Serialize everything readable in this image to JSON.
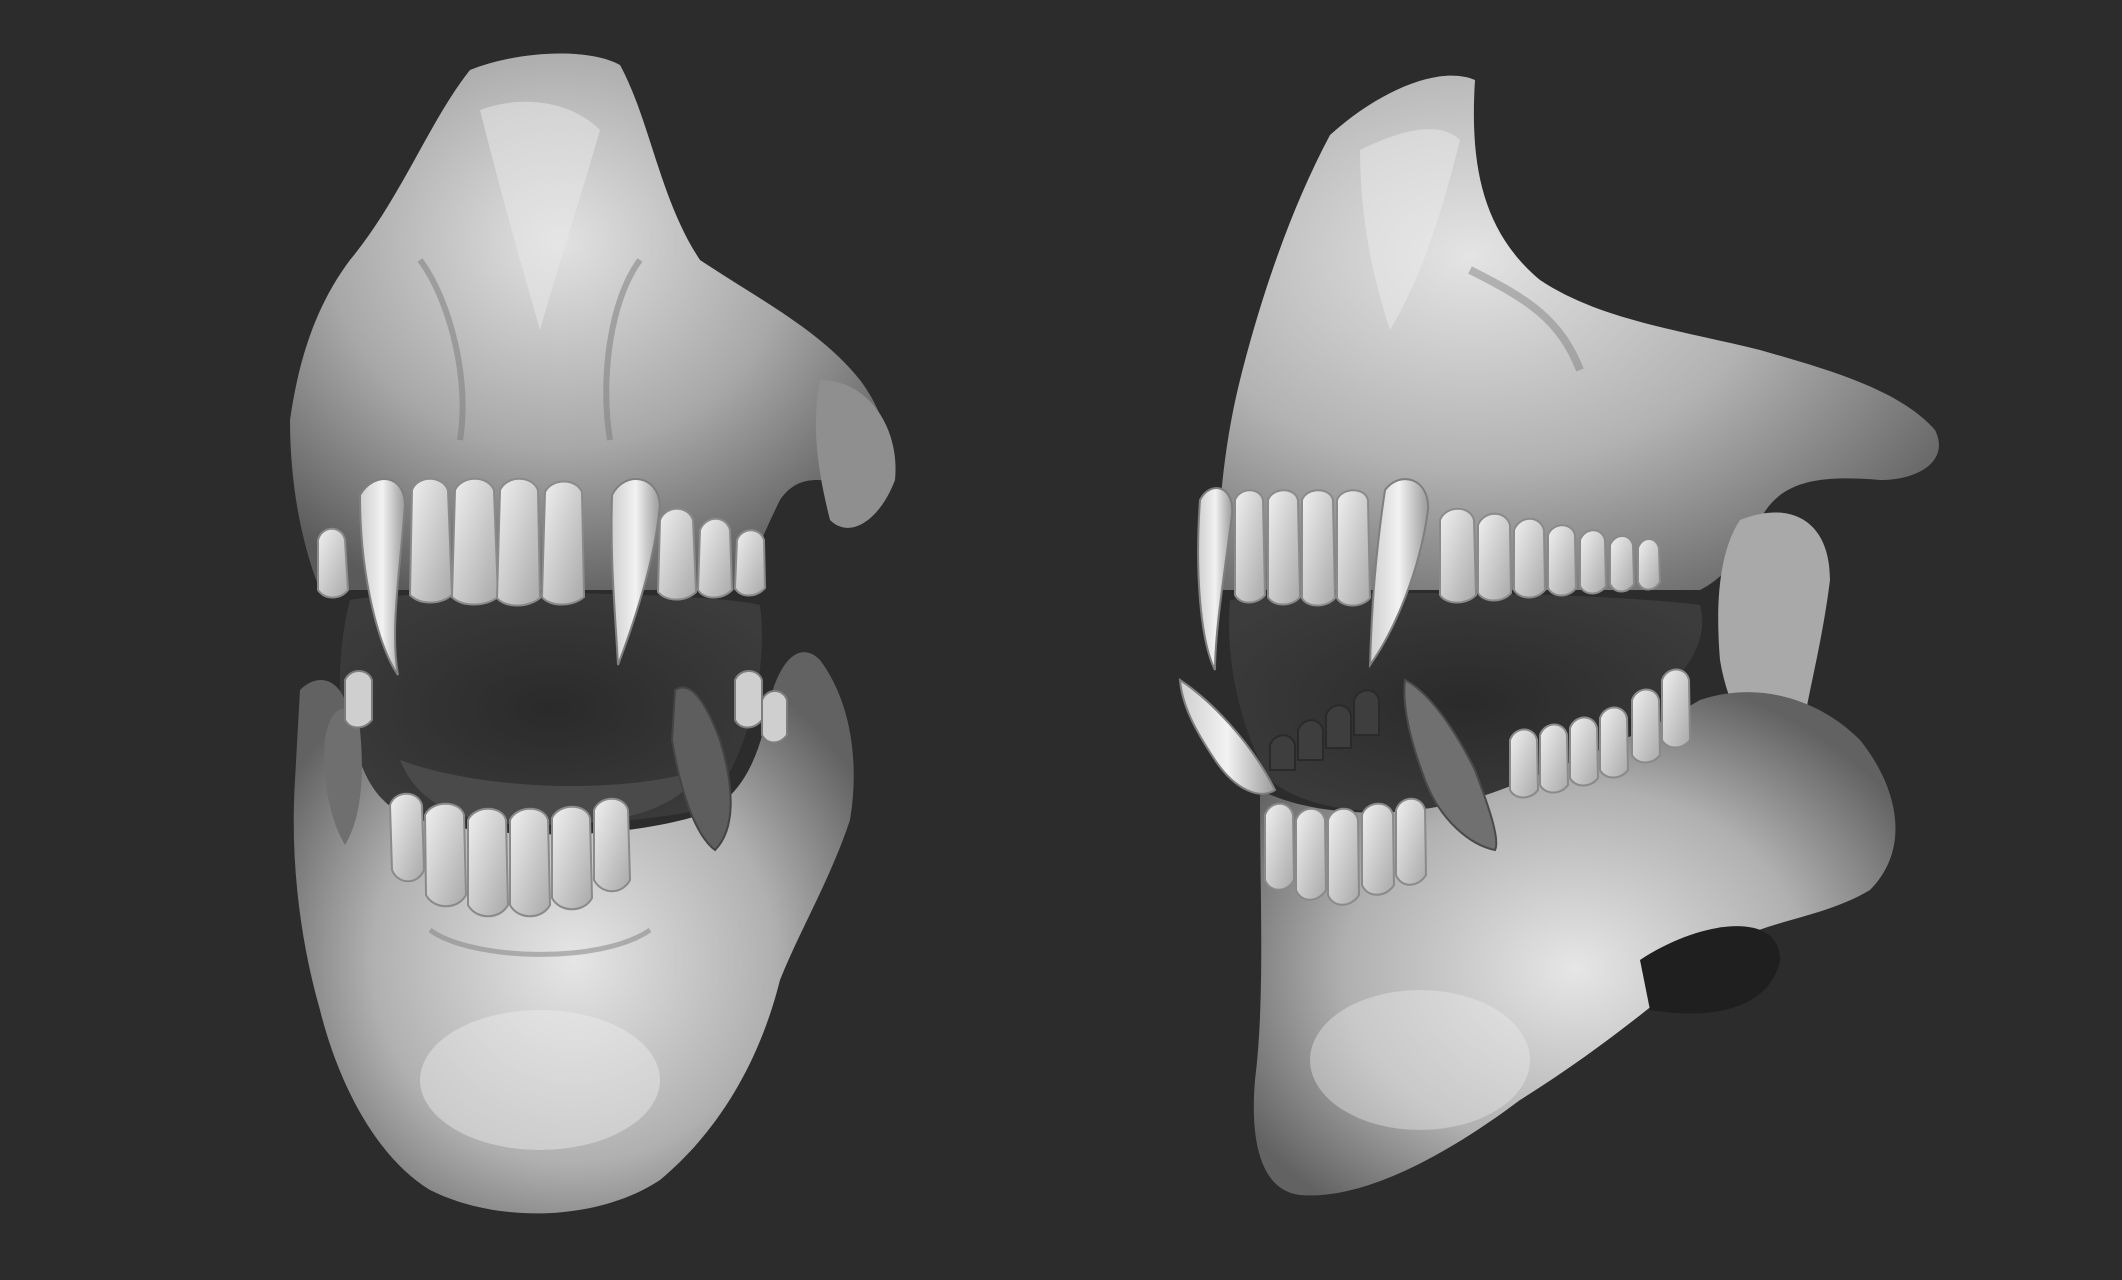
{
  "scene": {
    "background_color": "#2c2c2c",
    "render_style": "clay sculpt render, grayscale",
    "subjects": [
      {
        "view": "front",
        "icon": "fanged-jaw-front-icon"
      },
      {
        "view": "three-quarter",
        "icon": "fanged-jaw-side-icon"
      }
    ]
  },
  "colors": {
    "background": "#2c2c2c",
    "clay_light": "#d8d8d8",
    "clay_mid": "#9a9a9a",
    "clay_dark": "#555555",
    "tooth": "#e4e4e4",
    "mouth_shadow": "#3a3a3a"
  }
}
